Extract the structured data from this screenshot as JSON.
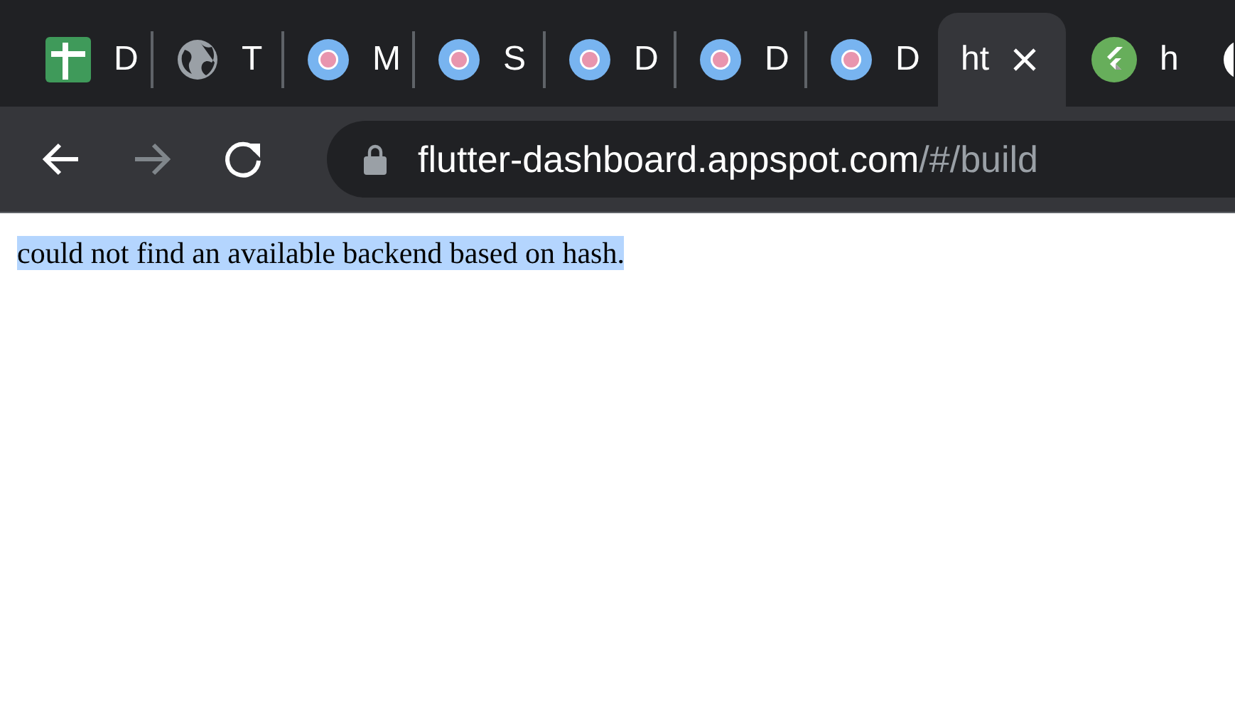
{
  "tabs": [
    {
      "kind": "sheet",
      "title": "D",
      "selected": false
    },
    {
      "kind": "globe",
      "title": "T",
      "selected": false
    },
    {
      "kind": "dot",
      "title": "M",
      "selected": false
    },
    {
      "kind": "dot",
      "title": "S",
      "selected": false
    },
    {
      "kind": "dot",
      "title": "D",
      "selected": false
    },
    {
      "kind": "dot",
      "title": "D",
      "selected": false
    },
    {
      "kind": "dot",
      "title": "D",
      "selected": false
    },
    {
      "kind": "plain",
      "title": "ht",
      "selected": true
    },
    {
      "kind": "flutter",
      "title": "h",
      "selected": false
    },
    {
      "kind": "partial",
      "selected": false
    }
  ],
  "toolbar": {
    "back_disabled": false,
    "forward_disabled": true
  },
  "address": {
    "host": "flutter-dashboard.appspot.com",
    "path": "/#/build"
  },
  "page": {
    "message": "could not find an available backend based on hash.",
    "selected": true
  }
}
